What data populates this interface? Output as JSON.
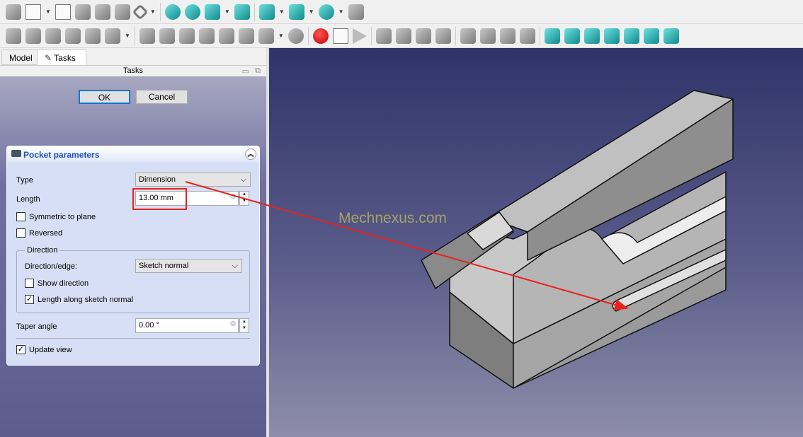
{
  "tabs": [
    {
      "label": "Model"
    },
    {
      "label": "Tasks"
    }
  ],
  "panel_title": "Tasks",
  "buttons": {
    "ok": "OK",
    "cancel": "Cancel"
  },
  "pocket": {
    "title": "Pocket parameters",
    "type_label": "Type",
    "type_value": "Dimension",
    "length_label": "Length",
    "length_value": "13.00 mm",
    "symmetric_label": "Symmetric to plane",
    "symmetric_checked": false,
    "reversed_label": "Reversed",
    "reversed_checked": false,
    "direction_group": "Direction",
    "direction_edge_label": "Direction/edge:",
    "direction_edge_value": "Sketch normal",
    "show_direction_label": "Show direction",
    "show_direction_checked": false,
    "along_normal_label": "Length along sketch normal",
    "along_normal_checked": true,
    "taper_label": "Taper angle",
    "taper_value": "0.00 °",
    "update_view_label": "Update view",
    "update_view_checked": true
  },
  "watermark": "Mechnexus.com",
  "colors": {
    "highlight": "#e8221e",
    "view_top": "#2f3368",
    "view_bottom": "#8e8eaa"
  }
}
